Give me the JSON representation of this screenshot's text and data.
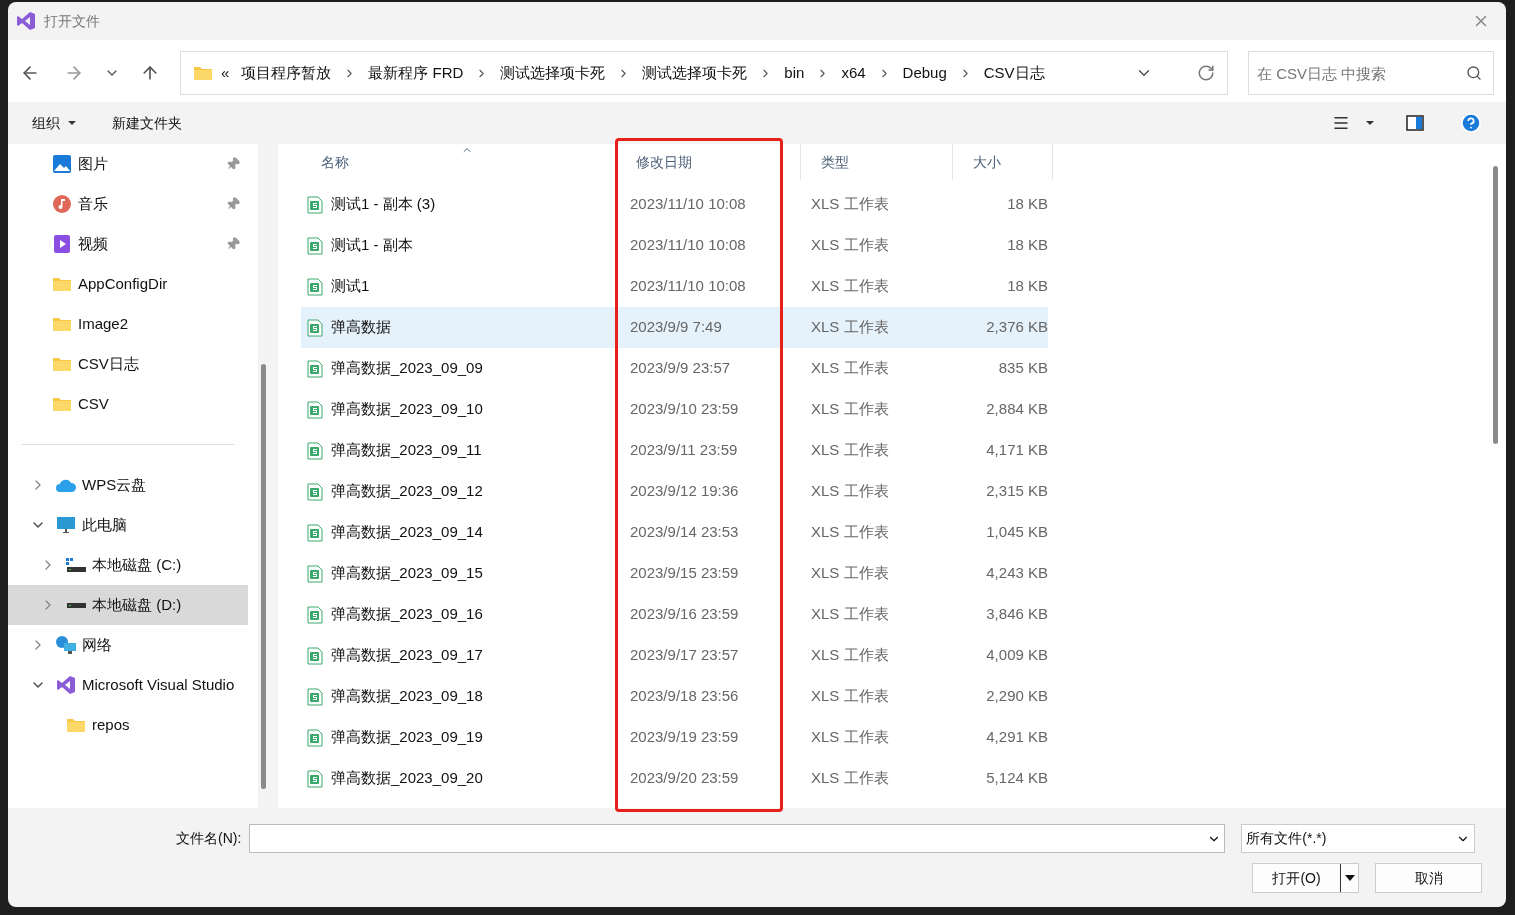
{
  "window": {
    "title": "打开文件"
  },
  "address": {
    "overflow": "«",
    "crumbs": [
      "项目程序暂放",
      "最新程序 FRD",
      "测试选择项卡死",
      "测试选择项卡死",
      "bin",
      "x64",
      "Debug",
      "CSV日志"
    ]
  },
  "search": {
    "placeholder": "在 CSV日志 中搜索"
  },
  "toolbar": {
    "organize": "组织",
    "new_folder": "新建文件夹"
  },
  "quick_access": [
    {
      "label": "图片",
      "kind": "pictures",
      "pinned": true
    },
    {
      "label": "音乐",
      "kind": "music",
      "pinned": true
    },
    {
      "label": "视频",
      "kind": "videos",
      "pinned": true
    },
    {
      "label": "AppConfigDir",
      "kind": "folder",
      "pinned": false
    },
    {
      "label": "Image2",
      "kind": "folder",
      "pinned": false
    },
    {
      "label": "CSV日志",
      "kind": "folder",
      "pinned": false
    },
    {
      "label": "CSV",
      "kind": "folder",
      "pinned": false
    }
  ],
  "tree": [
    {
      "label": "WPS云盘",
      "kind": "cloud",
      "expanded": false,
      "selected": false
    },
    {
      "label": "此电脑",
      "kind": "pc",
      "expanded": true,
      "selected": false,
      "children": [
        {
          "label": "本地磁盘 (C:)",
          "kind": "system-drive",
          "expanded": false,
          "selected": false
        },
        {
          "label": "本地磁盘 (D:)",
          "kind": "drive",
          "expanded": false,
          "selected": true
        }
      ]
    },
    {
      "label": "网络",
      "kind": "network",
      "expanded": false,
      "selected": false
    },
    {
      "label": "Microsoft Visual Studio",
      "kind": "vs",
      "expanded": true,
      "selected": false,
      "children": [
        {
          "label": "repos",
          "kind": "folder",
          "selected": false
        }
      ]
    }
  ],
  "table": {
    "columns": [
      "名称",
      "修改日期",
      "类型",
      "大小"
    ],
    "rows": [
      {
        "name": "测试1 - 副本 (3)",
        "date": "2023/11/10 10:08",
        "type": "XLS 工作表",
        "size": "18 KB",
        "selected": false
      },
      {
        "name": "测试1 - 副本",
        "date": "2023/11/10 10:08",
        "type": "XLS 工作表",
        "size": "18 KB",
        "selected": false
      },
      {
        "name": "测试1",
        "date": "2023/11/10 10:08",
        "type": "XLS 工作表",
        "size": "18 KB",
        "selected": false
      },
      {
        "name": "弹高数据",
        "date": "2023/9/9 7:49",
        "type": "XLS 工作表",
        "size": "2,376 KB",
        "selected": true
      },
      {
        "name": "弹高数据_2023_09_09",
        "date": "2023/9/9 23:57",
        "type": "XLS 工作表",
        "size": "835 KB",
        "selected": false
      },
      {
        "name": "弹高数据_2023_09_10",
        "date": "2023/9/10 23:59",
        "type": "XLS 工作表",
        "size": "2,884 KB",
        "selected": false
      },
      {
        "name": "弹高数据_2023_09_11",
        "date": "2023/9/11 23:59",
        "type": "XLS 工作表",
        "size": "4,171 KB",
        "selected": false
      },
      {
        "name": "弹高数据_2023_09_12",
        "date": "2023/9/12 19:36",
        "type": "XLS 工作表",
        "size": "2,315 KB",
        "selected": false
      },
      {
        "name": "弹高数据_2023_09_14",
        "date": "2023/9/14 23:53",
        "type": "XLS 工作表",
        "size": "1,045 KB",
        "selected": false
      },
      {
        "name": "弹高数据_2023_09_15",
        "date": "2023/9/15 23:59",
        "type": "XLS 工作表",
        "size": "4,243 KB",
        "selected": false
      },
      {
        "name": "弹高数据_2023_09_16",
        "date": "2023/9/16 23:59",
        "type": "XLS 工作表",
        "size": "3,846 KB",
        "selected": false
      },
      {
        "name": "弹高数据_2023_09_17",
        "date": "2023/9/17 23:57",
        "type": "XLS 工作表",
        "size": "4,009 KB",
        "selected": false
      },
      {
        "name": "弹高数据_2023_09_18",
        "date": "2023/9/18 23:56",
        "type": "XLS 工作表",
        "size": "2,290 KB",
        "selected": false
      },
      {
        "name": "弹高数据_2023_09_19",
        "date": "2023/9/19 23:59",
        "type": "XLS 工作表",
        "size": "4,291 KB",
        "selected": false
      },
      {
        "name": "弹高数据_2023_09_20",
        "date": "2023/9/20 23:59",
        "type": "XLS 工作表",
        "size": "5,124 KB",
        "selected": false
      }
    ]
  },
  "footer": {
    "filename_label": "文件名(N):",
    "filter": "所有文件(*.*)",
    "open": "打开(O)",
    "cancel": "取消"
  }
}
